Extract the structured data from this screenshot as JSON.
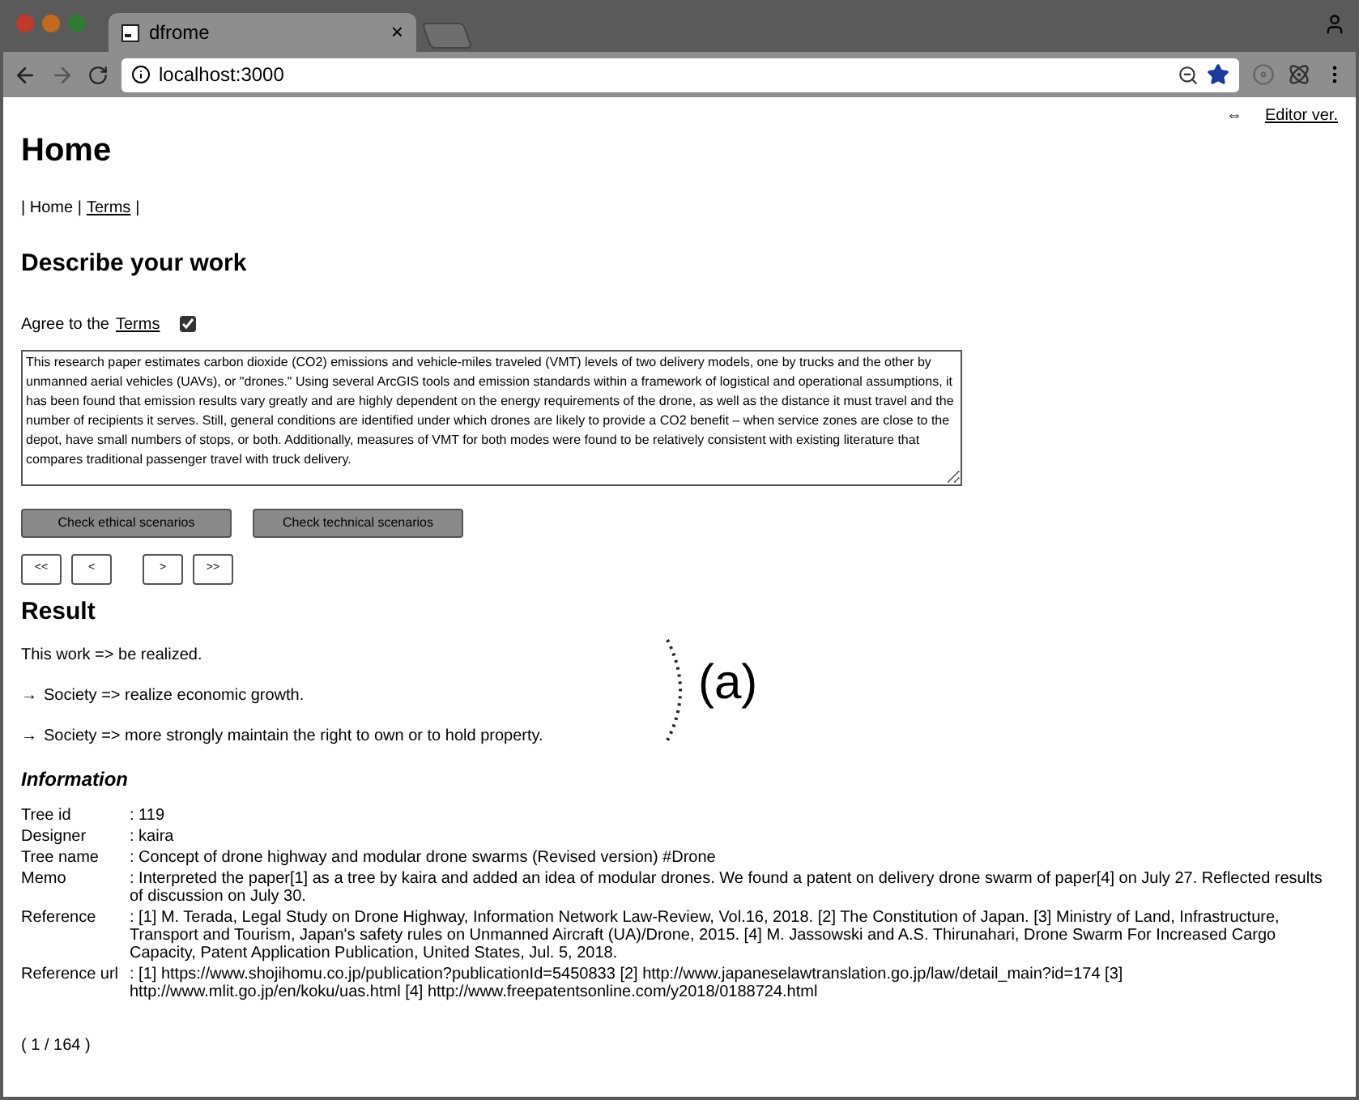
{
  "browser": {
    "tab_title": "dfrome",
    "tab_close": "×",
    "url": "localhost:3000"
  },
  "editor_link": {
    "icon": "⇔",
    "label": "Editor ver."
  },
  "title": "Home",
  "nav": [
    {
      "kind": "text",
      "label": "| Home |"
    },
    {
      "kind": "link",
      "label": "Terms"
    },
    {
      "kind": "text",
      "label": "|"
    }
  ],
  "describe": {
    "heading": "Describe your work",
    "agree_prefix": "Agree to the",
    "agree_link": "Terms",
    "agreed": true,
    "text": "This research paper estimates carbon dioxide (CO2) emissions and vehicle-miles traveled (VMT) levels of two delivery models, one by trucks and the other by unmanned aerial vehicles (UAVs), or \"drones.\" Using several ArcGIS tools and emission standards within a framework of logistical and operational assumptions, it has been found that emission results vary greatly and are highly dependent on the energy requirements of the drone, as well as the distance it must travel and the number of recipients it serves. Still, general conditions are identified under which drones are likely to provide a CO2 benefit – when service zones are close to the depot, have small numbers of stops, or both. Additionally, measures of VMT for both modes were found to be relatively consistent with existing literature that compares traditional passenger travel with truck delivery."
  },
  "actions": [
    "Check ethical scenarios",
    "Check technical scenarios"
  ],
  "pager": [
    [
      "<<",
      "<"
    ],
    [
      ">",
      ">>"
    ]
  ],
  "result": {
    "heading": "Result",
    "lines": [
      {
        "text": "This work => be realized."
      },
      {
        "arrow": "→",
        "text": "Society => realize economic growth."
      },
      {
        "arrow": "→",
        "text": "Society => more strongly maintain the right to own or to hold property."
      }
    ],
    "annotation": "(a)"
  },
  "information": {
    "heading": "Information",
    "rows": [
      {
        "label": "Tree id",
        "value": ": 119"
      },
      {
        "label": "Designer",
        "value": ": kaira"
      },
      {
        "label": "Tree name",
        "value": ": Concept of drone highway and modular drone swarms (Revised version) #Drone"
      },
      {
        "label": "Memo",
        "value": ": Interpreted the paper[1] as a tree by kaira and added an idea of modular drones. We found a patent on delivery drone swarm of paper[4] on July 27. Reflected results of discussion on July 30."
      },
      {
        "label": "Reference",
        "value": ": [1] M. Terada, Legal Study on Drone Highway, Information Network Law-Review, Vol.16, 2018. [2] The Constitution of Japan. [3] Ministry of Land, Infrastructure, Transport and Tourism, Japan's safety rules on Unmanned Aircraft (UA)/Drone, 2015. [4] M. Jassowski and A.S. Thirunahari, Drone Swarm For Increased Cargo Capacity, Patent Application Publication, United States, Jul. 5, 2018."
      },
      {
        "label": "Reference url",
        "value": ": [1] https://www.shojihomu.co.jp/publication?publicationId=5450833 [2] http://www.japaneselawtranslation.go.jp/law/detail_main?id=174 [3] http://www.mlit.go.jp/en/koku/uas.html [4] http://www.freepatentsonline.com/y2018/0188724.html"
      }
    ]
  },
  "page_count": "( 1 / 164 )"
}
